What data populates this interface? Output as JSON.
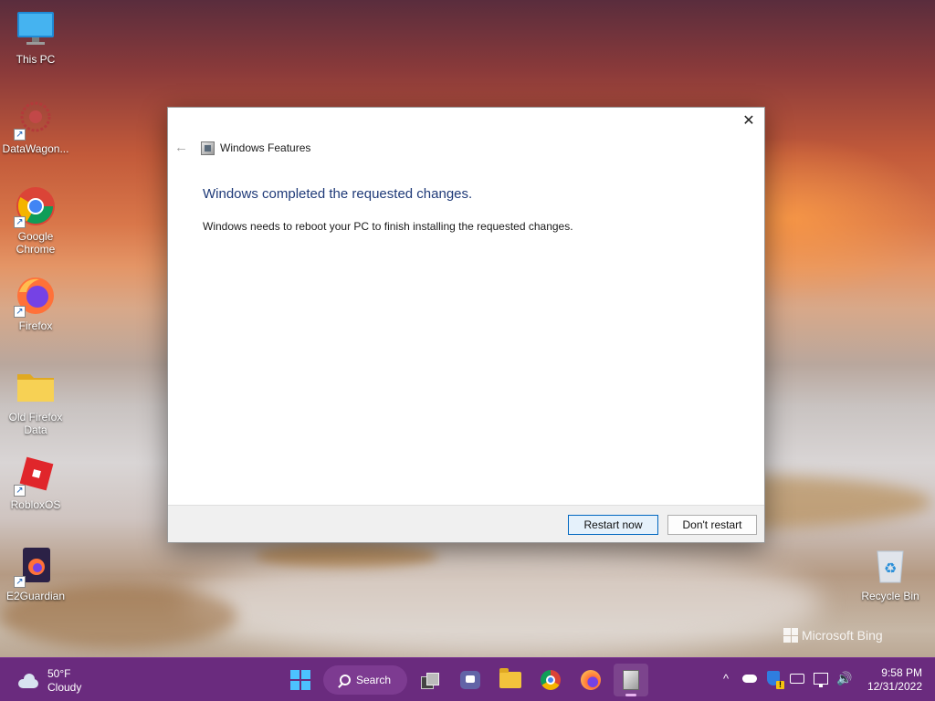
{
  "desktop": {
    "icons": [
      {
        "label": "This PC",
        "icon": "monitor-icon"
      },
      {
        "label": "DataWagon...",
        "icon": "datawagon-icon"
      },
      {
        "label": "Google Chrome",
        "icon": "chrome-icon"
      },
      {
        "label": "Firefox",
        "icon": "firefox-icon"
      },
      {
        "label": "Old Firefox Data",
        "icon": "folder-icon"
      },
      {
        "label": "RobloxOS",
        "icon": "roblox-icon"
      },
      {
        "label": "E2Guardian",
        "icon": "e2guardian-icon"
      },
      {
        "label": "Recycle Bin",
        "icon": "recycle-bin-icon"
      }
    ],
    "watermark": "Microsoft Bing"
  },
  "dialog": {
    "title": "Windows Features",
    "heading": "Windows completed the requested changes.",
    "body": "Windows needs to reboot your PC to finish installing the requested changes.",
    "primary_button": "Restart now",
    "secondary_button": "Don't restart",
    "close_glyph": "✕",
    "back_glyph": "←",
    "heading_color": "#1f3a78"
  },
  "taskbar": {
    "weather": {
      "temp": "50°F",
      "condition": "Cloudy"
    },
    "search_label": "Search",
    "apps": [
      "start-icon",
      "search",
      "task-view-icon",
      "teams-icon",
      "file-explorer-icon",
      "chrome-icon",
      "firefox-icon",
      "windows-features-icon"
    ],
    "tray_chevron": "^",
    "clock": {
      "time": "9:58 PM",
      "date": "12/31/2022"
    },
    "color": "#6a2b7e"
  }
}
